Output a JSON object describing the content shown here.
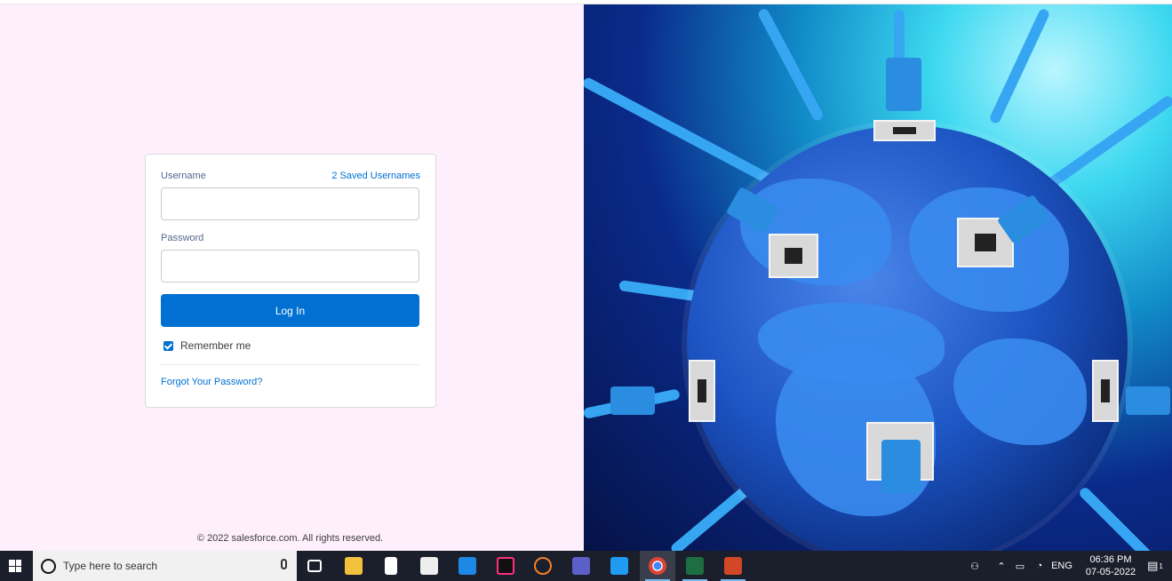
{
  "login": {
    "username_label": "Username",
    "saved_usernames_link": "2 Saved Usernames",
    "username_value": "",
    "password_label": "Password",
    "password_value": "",
    "login_button": "Log In",
    "remember_me_label": "Remember me",
    "remember_me_checked": true,
    "forgot_password_link": "Forgot Your Password?"
  },
  "footer": {
    "copyright": "© 2022 salesforce.com. All rights reserved."
  },
  "hero_image": {
    "icon": "globe-network-illustration"
  },
  "taskbar": {
    "search_placeholder": "Type here to search",
    "apps": [
      {
        "name": "task-view",
        "label": ""
      },
      {
        "name": "file-explorer",
        "label": ""
      },
      {
        "name": "notepad",
        "label": ""
      },
      {
        "name": "microsoft-store",
        "label": ""
      },
      {
        "name": "mail",
        "label": ""
      },
      {
        "name": "intellij",
        "label": ""
      },
      {
        "name": "eclipse",
        "label": ""
      },
      {
        "name": "teams",
        "label": ""
      },
      {
        "name": "vscode",
        "label": ""
      },
      {
        "name": "chrome",
        "label": ""
      },
      {
        "name": "excel",
        "label": ""
      },
      {
        "name": "powerpoint",
        "label": ""
      }
    ],
    "language": "ENG",
    "time": "06:36 PM",
    "date": "07-05-2022",
    "notification_count": "1"
  }
}
